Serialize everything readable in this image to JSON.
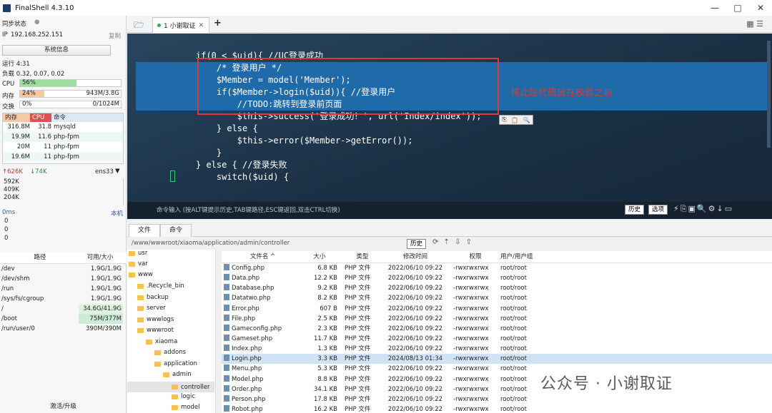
{
  "window": {
    "title": "FinalShell 4.3.10",
    "min": "—",
    "max": "□",
    "close": "✕"
  },
  "left": {
    "sync_label": "同步状态",
    "ip_label": "IP",
    "ip": "192.168.252.151",
    "copy": "复制",
    "sysinfo": "系统信息",
    "uptime": "运行 4:31",
    "load": "负载 0.32, 0.07, 0.02",
    "cpu_label": "CPU",
    "cpu_value": "56%",
    "cpu_fraction": 0.56,
    "mem_label": "内存",
    "mem_value": "24%",
    "mem_fraction": 0.24,
    "mem_total": "943M/3.8G",
    "swap_label": "交换",
    "swap_value": "0%",
    "swap_total": "0/1024M",
    "proc_headers": [
      "内存",
      "CPU",
      "命令"
    ],
    "procs": [
      {
        "mem": "316.8M",
        "cpu": "31.8",
        "cmd": "mysqld"
      },
      {
        "mem": "19.9M",
        "cpu": "11.6",
        "cmd": "php-fpm"
      },
      {
        "mem": "20M",
        "cpu": "11",
        "cmd": "php-fpm"
      },
      {
        "mem": "19.6M",
        "cpu": "11",
        "cmd": "php-fpm"
      }
    ],
    "net_up": "↑626K",
    "net_down": "↓74K",
    "net_iface": "ens33",
    "net_scale": [
      "592K",
      "409K",
      "204K"
    ],
    "ping_label": "0ms",
    "ping_host": "本机",
    "ping_vals": [
      "0",
      "0",
      "0"
    ],
    "disk_headers": [
      "路径",
      "可用/大小"
    ],
    "disks": [
      {
        "path": "/dev",
        "size": "1.9G/1.9G"
      },
      {
        "path": "/dev/shm",
        "size": "1.9G/1.9G"
      },
      {
        "path": "/run",
        "size": "1.9G/1.9G"
      },
      {
        "path": "/sys/fs/cgroup",
        "size": "1.9G/1.9G"
      },
      {
        "path": "/",
        "size": "34.6G/41.9G"
      },
      {
        "path": "/boot",
        "size": "75M/377M"
      },
      {
        "path": "/run/user/0",
        "size": "390M/390M"
      }
    ],
    "activate": "激活/升级"
  },
  "tabs": {
    "active": "1 小谢取证",
    "add": "+"
  },
  "terminal": {
    "lines": [
      "if(0 < $uid){ //UC登录成功",
      "    /* 登录用户 */",
      "    $Member = model('Member');",
      "    if($Member->login($uid)){ //登录用户",
      "        //TODO:跳转到登录前页面",
      "        $this->success('登录成功！', url('Index/index'));",
      "    } else {",
      "        $this->error($Member->getError());",
      "    }",
      "",
      "} else { //登录失败",
      "    switch($uid) {"
    ],
    "annotation": "将此段代码放在校验之前"
  },
  "cmdbar": {
    "hint": "命令输入 (按ALT键提示历史,TAB键路径,ESC键返回,双击CTRL切换)",
    "history": "历史",
    "options": "选项"
  },
  "filetabs": {
    "files": "文件",
    "cmd": "命令"
  },
  "path": {
    "value": "/www/wwwroot/xiaoma/application/admin/controller",
    "history": "历史"
  },
  "tree": [
    "usr",
    "var",
    "www",
    ".Recycle_bin",
    "backup",
    "server",
    "wwwlogs",
    "wwwroot",
    "xiaoma",
    "addons",
    "application",
    "admin",
    "controller",
    "logic",
    "model"
  ],
  "files": {
    "headers": [
      "文件名 ^",
      "大小",
      "类型",
      "修改时间",
      "权限",
      "用户/用户组"
    ],
    "rows": [
      [
        "Config.php",
        "6.8 KB",
        "PHP 文件",
        "2022/06/10 09:22",
        "-rwxrwxrwx",
        "root/root"
      ],
      [
        "Data.php",
        "12.2 KB",
        "PHP 文件",
        "2022/06/10 09:22",
        "-rwxrwxrwx",
        "root/root"
      ],
      [
        "Database.php",
        "9.2 KB",
        "PHP 文件",
        "2022/06/10 09:22",
        "-rwxrwxrwx",
        "root/root"
      ],
      [
        "Datatwo.php",
        "8.2 KB",
        "PHP 文件",
        "2022/06/10 09:22",
        "-rwxrwxrwx",
        "root/root"
      ],
      [
        "Error.php",
        "607 B",
        "PHP 文件",
        "2022/06/10 09:22",
        "-rwxrwxrwx",
        "root/root"
      ],
      [
        "File.php",
        "2.5 KB",
        "PHP 文件",
        "2022/06/10 09:22",
        "-rwxrwxrwx",
        "root/root"
      ],
      [
        "Gameconfig.php",
        "2.3 KB",
        "PHP 文件",
        "2022/06/10 09:22",
        "-rwxrwxrwx",
        "root/root"
      ],
      [
        "Gameset.php",
        "11.7 KB",
        "PHP 文件",
        "2022/06/10 09:22",
        "-rwxrwxrwx",
        "root/root"
      ],
      [
        "Index.php",
        "1.3 KB",
        "PHP 文件",
        "2022/06/10 09:22",
        "-rwxrwxrwx",
        "root/root"
      ],
      [
        "Login.php",
        "3.3 KB",
        "PHP 文件",
        "2024/08/13 01:34",
        "-rwxrwxrwx",
        "root/root"
      ],
      [
        "Menu.php",
        "5.3 KB",
        "PHP 文件",
        "2022/06/10 09:22",
        "-rwxrwxrwx",
        "root/root"
      ],
      [
        "Model.php",
        "8.8 KB",
        "PHP 文件",
        "2022/06/10 09:22",
        "-rwxrwxrwx",
        "root/root"
      ],
      [
        "Order.php",
        "34.1 KB",
        "PHP 文件",
        "2022/06/10 09:22",
        "-rwxrwxrwx",
        "root/root"
      ],
      [
        "Person.php",
        "17.8 KB",
        "PHP 文件",
        "2022/06/10 09:22",
        "-rwxrwxrwx",
        "root/root"
      ],
      [
        "Robot.php",
        "16.2 KB",
        "PHP 文件",
        "2022/06/10 09:22",
        "-rwxrwxrwx",
        "root/root"
      ]
    ]
  },
  "watermark": "公众号 · 小谢取证",
  "colors": {
    "cpu_bar": "#9fdc9f",
    "mem_bar": "#f7c79d",
    "selection": "#1f6aa9",
    "annotation": "#e03a2e"
  }
}
